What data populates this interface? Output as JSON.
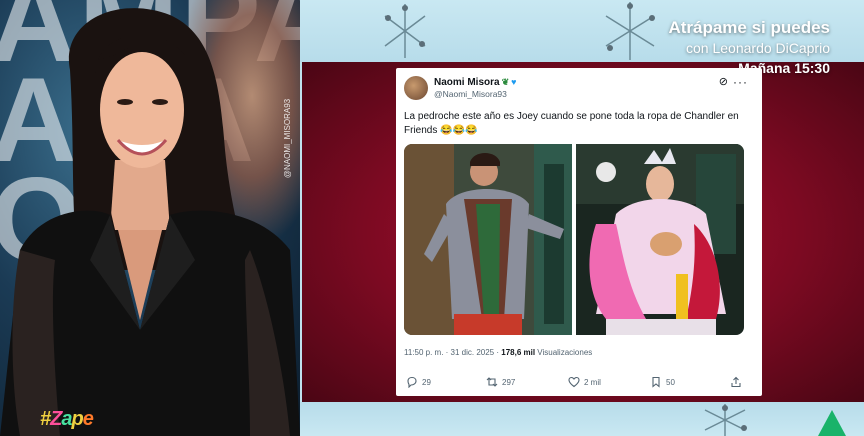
{
  "studio": {
    "sign_text": "AMPA\nADA\nO",
    "brand": {
      "hash": "#",
      "z": "Z",
      "a": "a",
      "p": "p",
      "e": "e"
    }
  },
  "promo": {
    "line1": "Atrápame si puedes",
    "line2": "con Leonardo DiCaprio",
    "line3": "Mañana 15:30"
  },
  "watermark": "@NAOMI_MISORA93",
  "tweet": {
    "name": "Naomi Misora",
    "handle": "@Naomi_Misora93",
    "text": "La pedroche este año es Joey cuando se pone toda la ropa de Chandler en Friends 😂😂😂",
    "time": "11:50 p. m. · 31 dic. 2025 · ",
    "views_count": "178,6 mil",
    "views_label": " Visualizaciones",
    "replies": "29",
    "reposts": "297",
    "likes": "2 mil",
    "bookmarks": "50"
  },
  "icons": [
    "verified-badge-icon",
    "leaf-icon",
    "grok-icon",
    "more-icon",
    "reply-icon",
    "repost-icon",
    "like-icon",
    "bookmark-icon",
    "share-icon"
  ],
  "colors": {
    "screen_red": "#9a0c28",
    "panel_blue": "#bfe2ee",
    "twitter_blue": "#1d9bf0",
    "zapeando_green": "#19b36a"
  }
}
